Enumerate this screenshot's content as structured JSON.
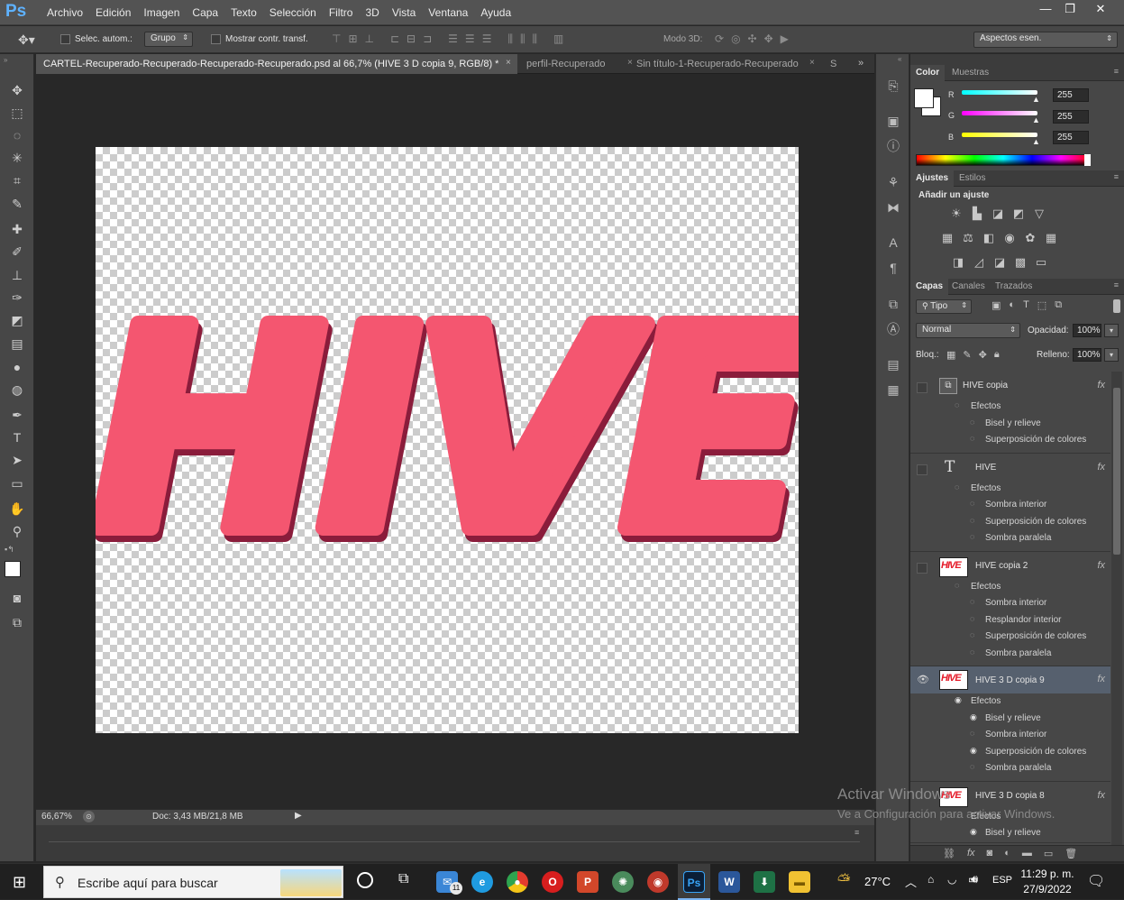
{
  "app": {
    "logo": "Ps"
  },
  "menu": [
    "Archivo",
    "Edición",
    "Imagen",
    "Capa",
    "Texto",
    "Selección",
    "Filtro",
    "3D",
    "Vista",
    "Ventana",
    "Ayuda"
  ],
  "window_controls": {
    "minimize": "—",
    "restore": "❐",
    "close": "✕"
  },
  "options": {
    "auto_select_label": "Selec. autom.:",
    "auto_select_value": "Grupo",
    "show_transform_label": "Mostrar contr. transf.",
    "mode3d_label": "Modo 3D:",
    "workspace": "Aspectos esen."
  },
  "tabs": [
    {
      "label": "CARTEL-Recuperado-Recuperado-Recuperado-Recuperado.psd al 66,7% (HIVE  3 D copia 9, RGB/8) *",
      "active": true
    },
    {
      "label": "perfil-Recuperado",
      "active": false
    },
    {
      "label": "Sin título-1-Recuperado-Recuperado",
      "active": false
    },
    {
      "label": "S",
      "active": false
    }
  ],
  "canvas": {
    "text": "HIVE",
    "fill_color": "#f45670",
    "shadow_color": "#8a1f3b"
  },
  "status": {
    "zoom": "66,67%",
    "doc": "Doc: 3,43 MB/21,8 MB"
  },
  "color_panel": {
    "tabs": [
      "Color",
      "Muestras"
    ],
    "channels": [
      {
        "label": "R",
        "value": "255",
        "gradient": "linear-gradient(to right,#00ffff,#ffffff)"
      },
      {
        "label": "G",
        "value": "255",
        "gradient": "linear-gradient(to right,#ff00ff,#ffffff)"
      },
      {
        "label": "B",
        "value": "255",
        "gradient": "linear-gradient(to right,#ffff00,#ffffff)"
      }
    ]
  },
  "adjust_panel": {
    "tabs": [
      "Ajustes",
      "Estilos"
    ],
    "heading": "Añadir un ajuste"
  },
  "layers_panel": {
    "tabs": [
      "Capas",
      "Canales",
      "Trazados"
    ],
    "filter": "Tipo",
    "blend_mode": "Normal",
    "opacity_label": "Opacidad:",
    "opacity_value": "100%",
    "lock_label": "Bloq.:",
    "fill_label": "Relleno:",
    "fill_value": "100%",
    "fx_label": "fx",
    "layers": [
      {
        "name": "HIVE copia",
        "kind": "smart",
        "visible": false,
        "selected": false,
        "effects_label": "Efectos",
        "effects": [
          {
            "name": "Bisel y relieve"
          },
          {
            "name": "Superposición de colores"
          }
        ]
      },
      {
        "name": "HIVE",
        "kind": "text",
        "visible": false,
        "selected": false,
        "effects_label": "Efectos",
        "effects": [
          {
            "name": "Sombra interior"
          },
          {
            "name": "Superposición de colores"
          },
          {
            "name": "Sombra paralela"
          }
        ]
      },
      {
        "name": "HIVE copia 2",
        "kind": "image",
        "visible": false,
        "selected": false,
        "effects_label": "Efectos",
        "effects": [
          {
            "name": "Sombra interior"
          },
          {
            "name": "Resplandor interior"
          },
          {
            "name": "Superposición de colores"
          },
          {
            "name": "Sombra paralela"
          }
        ]
      },
      {
        "name": "HIVE  3 D copia 9",
        "kind": "image",
        "visible": true,
        "selected": true,
        "effects_label": "Efectos",
        "effects": [
          {
            "name": "Bisel y relieve"
          },
          {
            "name": "Sombra interior"
          },
          {
            "name": "Superposición de colores"
          },
          {
            "name": "Sombra paralela"
          }
        ]
      },
      {
        "name": "HIVE  3 D copia 8",
        "kind": "image",
        "visible": false,
        "selected": false,
        "effects_label": "Efectos",
        "effects": [
          {
            "name": "Bisel y relieve"
          }
        ]
      }
    ]
  },
  "watermark": {
    "line1": "Activar Windows",
    "line2": "Ve a Configuración para activar Windows."
  },
  "taskbar": {
    "search_placeholder": "Escribe aquí para buscar",
    "weather_temp": "27°C",
    "language": "ESP",
    "time": "11:29 p. m.",
    "date": "27/9/2022",
    "badge": "11"
  }
}
